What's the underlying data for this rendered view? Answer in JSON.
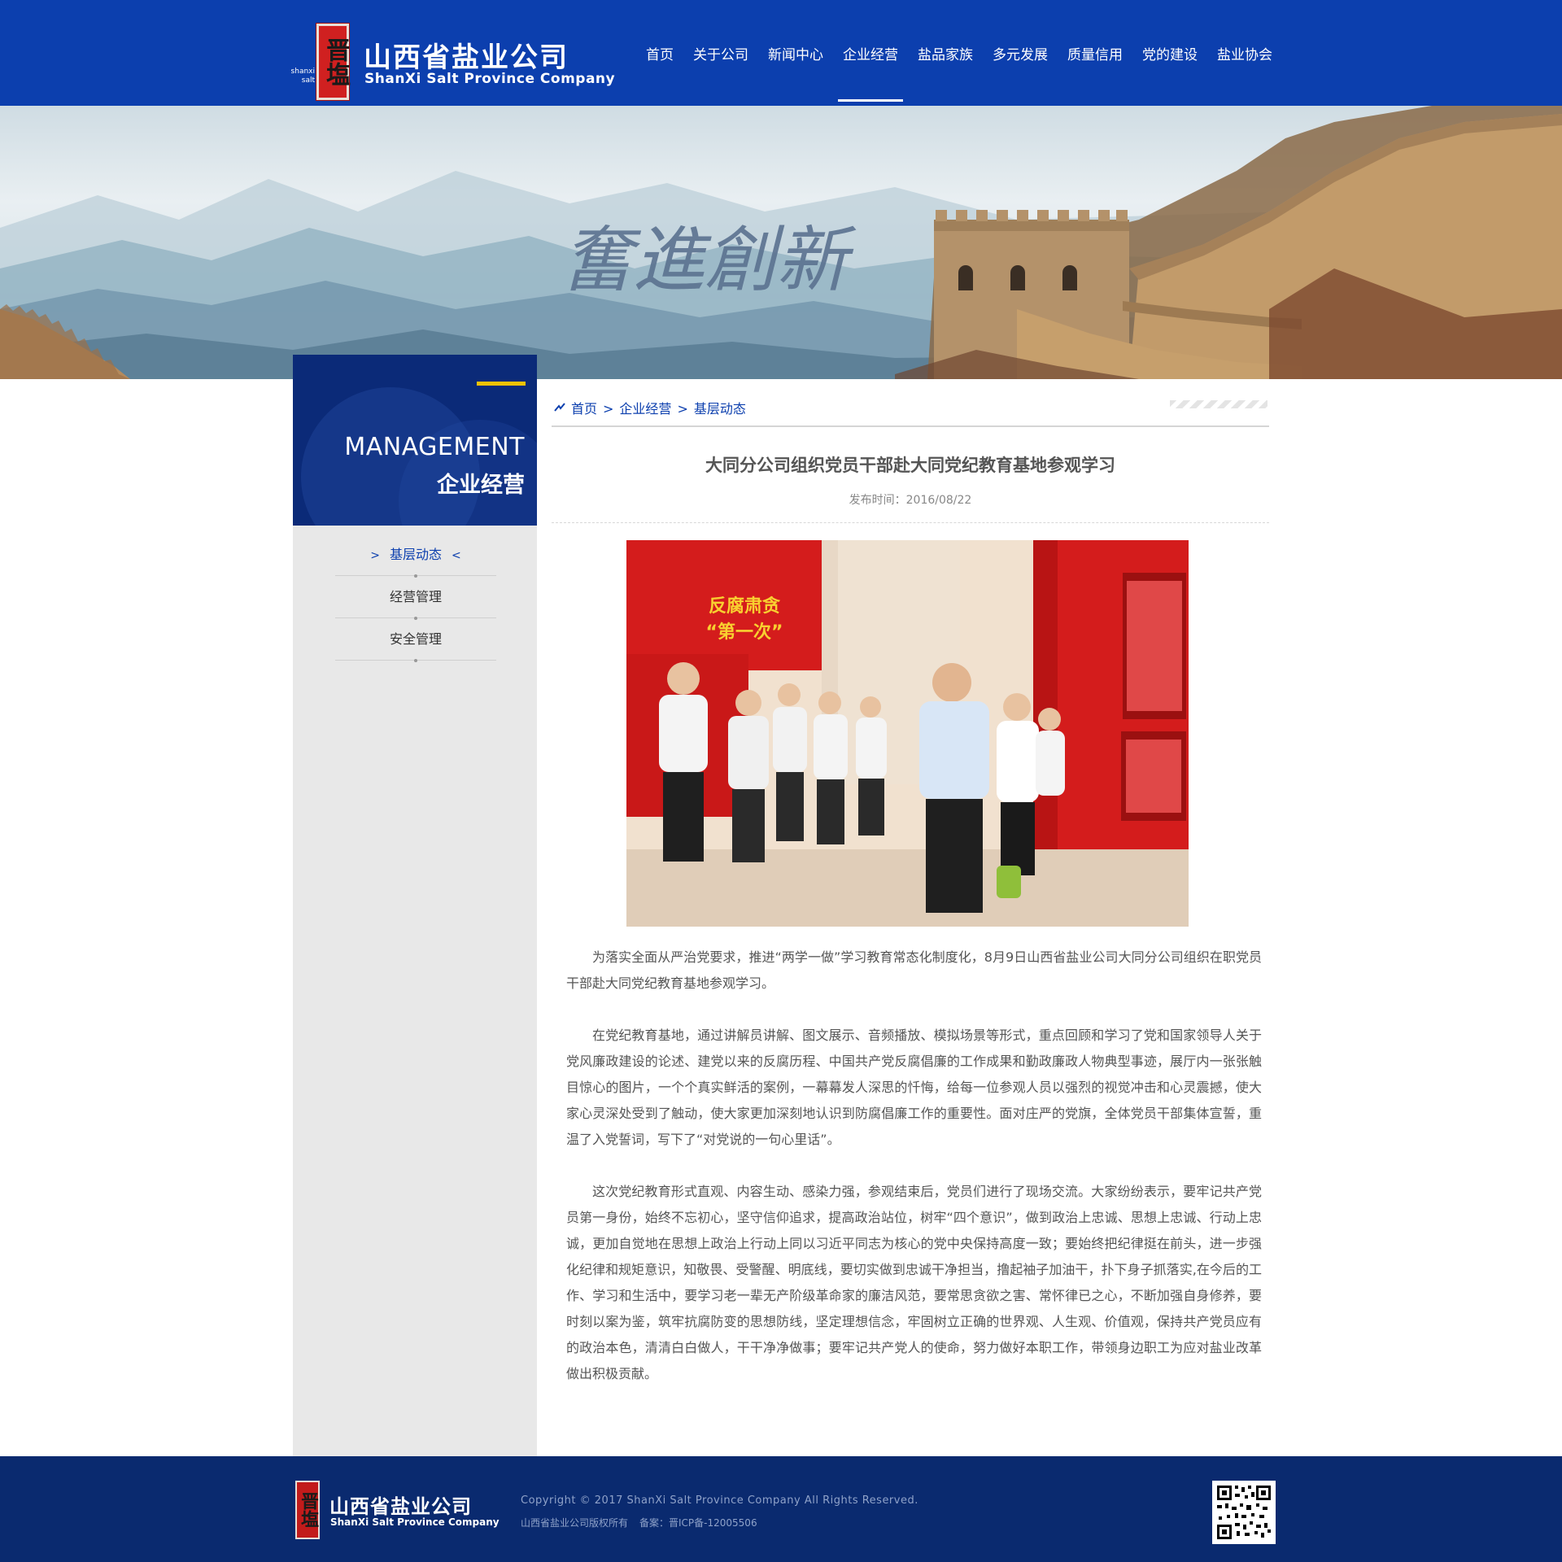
{
  "header": {
    "logo_seal": "晋塩",
    "logo_mini": [
      "shanxi",
      "salt"
    ],
    "logo_cn": "山西省盐业公司",
    "logo_en": "ShanXi Salt Province Company",
    "nav": [
      {
        "label": "首页",
        "active": false
      },
      {
        "label": "关于公司",
        "active": false
      },
      {
        "label": "新闻中心",
        "active": false
      },
      {
        "label": "企业经营",
        "active": true
      },
      {
        "label": "盐品家族",
        "active": false
      },
      {
        "label": "多元发展",
        "active": false
      },
      {
        "label": "质量信用",
        "active": false
      },
      {
        "label": "党的建设",
        "active": false
      },
      {
        "label": "盐业协会",
        "active": false
      }
    ]
  },
  "banner": {
    "calligraphy": "奮進創新"
  },
  "sidebar": {
    "title_en": "MANAGEMENT",
    "title_cn": "企业经营",
    "items": [
      {
        "label": "基层动态",
        "active": true
      },
      {
        "label": "经营管理",
        "active": false
      },
      {
        "label": "安全管理",
        "active": false
      }
    ]
  },
  "breadcrumb": {
    "home": "首页",
    "section": "企业经营",
    "current": "基层动态",
    "separator": ">"
  },
  "article": {
    "title": "大同分公司组织党员干部赴大同党纪教育基地参观学习",
    "date": "发布时间：2016/08/22",
    "photo_sign_1": "反腐肃贪",
    "photo_sign_2": "“第一次”",
    "paragraphs": [
      "为落实全面从严治党要求，推进“两学一做”学习教育常态化制度化，8月9日山西省盐业公司大同分公司组织在职党员干部赴大同党纪教育基地参观学习。",
      "在党纪教育基地，通过讲解员讲解、图文展示、音频播放、模拟场景等形式，重点回顾和学习了党和国家领导人关于党风廉政建设的论述、建党以来的反腐历程、中国共产党反腐倡廉的工作成果和勤政廉政人物典型事迹，展厅内一张张触目惊心的图片，一个个真实鲜活的案例，一幕幕发人深思的忏悔，给每一位参观人员以强烈的视觉冲击和心灵震撼，使大家心灵深处受到了触动，使大家更加深刻地认识到防腐倡廉工作的重要性。面对庄严的党旗，全体党员干部集体宣誓，重温了入党誓词，写下了“对党说的一句心里话”。",
      "这次党纪教育形式直观、内容生动、感染力强，参观结束后，党员们进行了现场交流。大家纷纷表示，要牢记共产党员第一身份，始终不忘初心，坚守信仰追求，提高政治站位，树牢“四个意识”，做到政治上忠诚、思想上忠诚、行动上忠诚，更加自觉地在思想上政治上行动上同以习近平同志为核心的党中央保持高度一致；要始终把纪律挺在前头，进一步强化纪律和规矩意识，知敬畏、受警醒、明底线，要切实做到忠诚干净担当，撸起袖子加油干，扑下身子抓落实,在今后的工作、学习和生活中，要学习老一辈无产阶级革命家的廉洁风范，要常思贪欲之害、常怀律已之心，不断加强自身修养，要时刻以案为鉴，筑牢抗腐防变的思想防线，坚定理想信念，牢固树立正确的世界观、人生观、价值观，保持共产党员应有的政治本色，清清白白做人，干干净净做事；要牢记共产党人的使命，努力做好本职工作，带领身边职工为应对盐业改革做出积极贡献。"
    ]
  },
  "footer": {
    "logo_seal": "晋塩",
    "logo_cn": "山西省盐业公司",
    "logo_en": "ShanXi Salt Province Company",
    "copyright": "Copyright © 2017 ShanXi Salt Province Company All Rights Reserved.",
    "rights": "山西省盐业公司版权所有",
    "icp": "备案：晋ICP备-12005506"
  },
  "colors": {
    "brand_blue": "#0c3fae",
    "sidebar_head": "#0b2a78",
    "footer_bg": "#0a2a6f",
    "accent_yellow": "#f2c200",
    "seal_red": "#d02020"
  },
  "icons": [
    "home-icon",
    "chevron-right-icon",
    "chevron-left-icon",
    "qr-code-icon"
  ]
}
